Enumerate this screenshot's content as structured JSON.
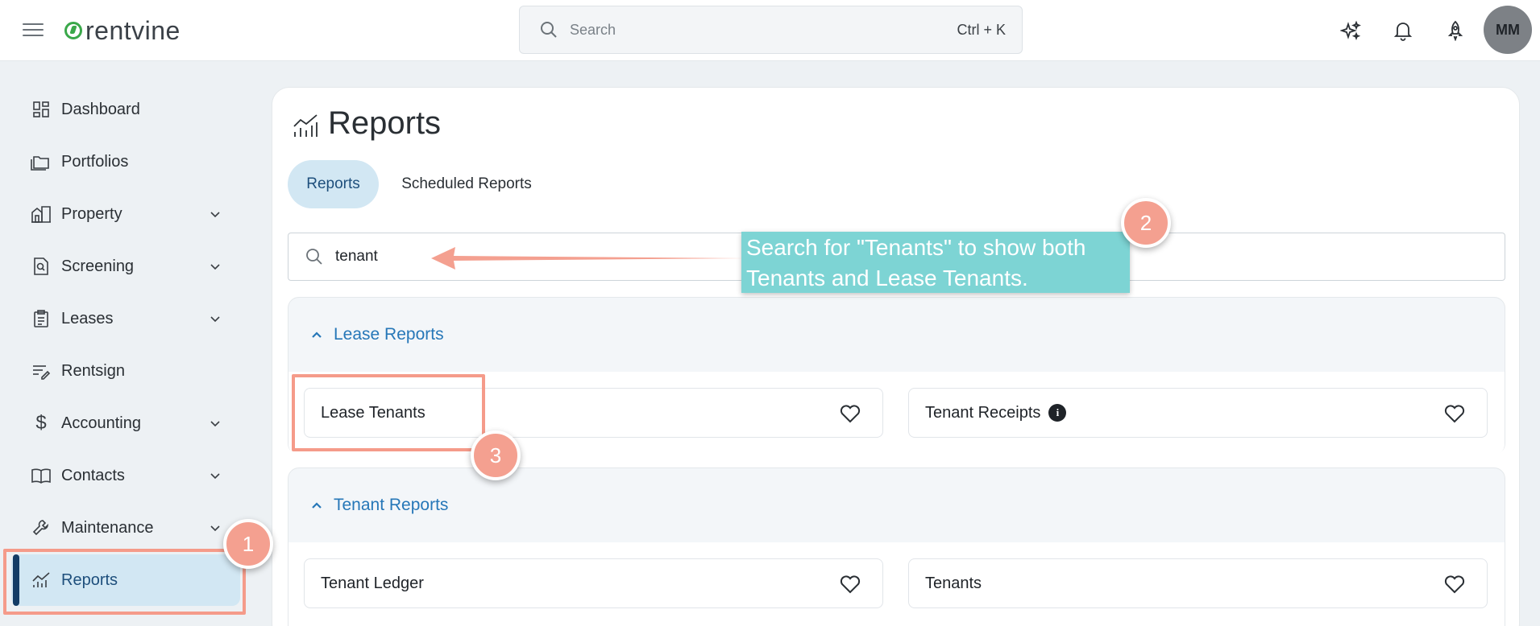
{
  "app": {
    "logo_text": "rentvine"
  },
  "header": {
    "search_placeholder": "Search",
    "search_shortcut": "Ctrl + K",
    "user_initials": "MM"
  },
  "sidebar": {
    "items": [
      {
        "label": "Dashboard",
        "icon": "dashboard-icon",
        "expandable": false
      },
      {
        "label": "Portfolios",
        "icon": "folder-icon",
        "expandable": false
      },
      {
        "label": "Property",
        "icon": "building-icon",
        "expandable": true
      },
      {
        "label": "Screening",
        "icon": "screening-icon",
        "expandable": true
      },
      {
        "label": "Leases",
        "icon": "clipboard-icon",
        "expandable": true
      },
      {
        "label": "Rentsign",
        "icon": "sign-icon",
        "expandable": false
      },
      {
        "label": "Accounting",
        "icon": "dollar-icon",
        "expandable": true
      },
      {
        "label": "Contacts",
        "icon": "book-icon",
        "expandable": true
      },
      {
        "label": "Maintenance",
        "icon": "wrench-icon",
        "expandable": true
      },
      {
        "label": "Reports",
        "icon": "chart-icon",
        "expandable": false,
        "active": true
      }
    ]
  },
  "main": {
    "title": "Reports",
    "tabs": [
      {
        "label": "Reports",
        "active": true
      },
      {
        "label": "Scheduled Reports",
        "active": false
      }
    ],
    "filter_value": "tenant",
    "sections": [
      {
        "title": "Lease Reports",
        "reports": [
          {
            "label": "Lease Tenants",
            "info": false
          },
          {
            "label": "Tenant Receipts",
            "info": true
          }
        ]
      },
      {
        "title": "Tenant Reports",
        "reports": [
          {
            "label": "Tenant Ledger",
            "info": false
          },
          {
            "label": "Tenants",
            "info": false
          }
        ]
      }
    ]
  },
  "annotations": {
    "callout_line1": "Search for \"Tenants\" to show both",
    "callout_line2": "Tenants and Lease Tenants.",
    "badge1": "1",
    "badge2": "2",
    "badge3": "3"
  },
  "colors": {
    "accent": "#2677b8",
    "active_bg": "#d2e7f3",
    "highlight": "#f59b8a",
    "callout_bg": "#7dd4d4"
  }
}
